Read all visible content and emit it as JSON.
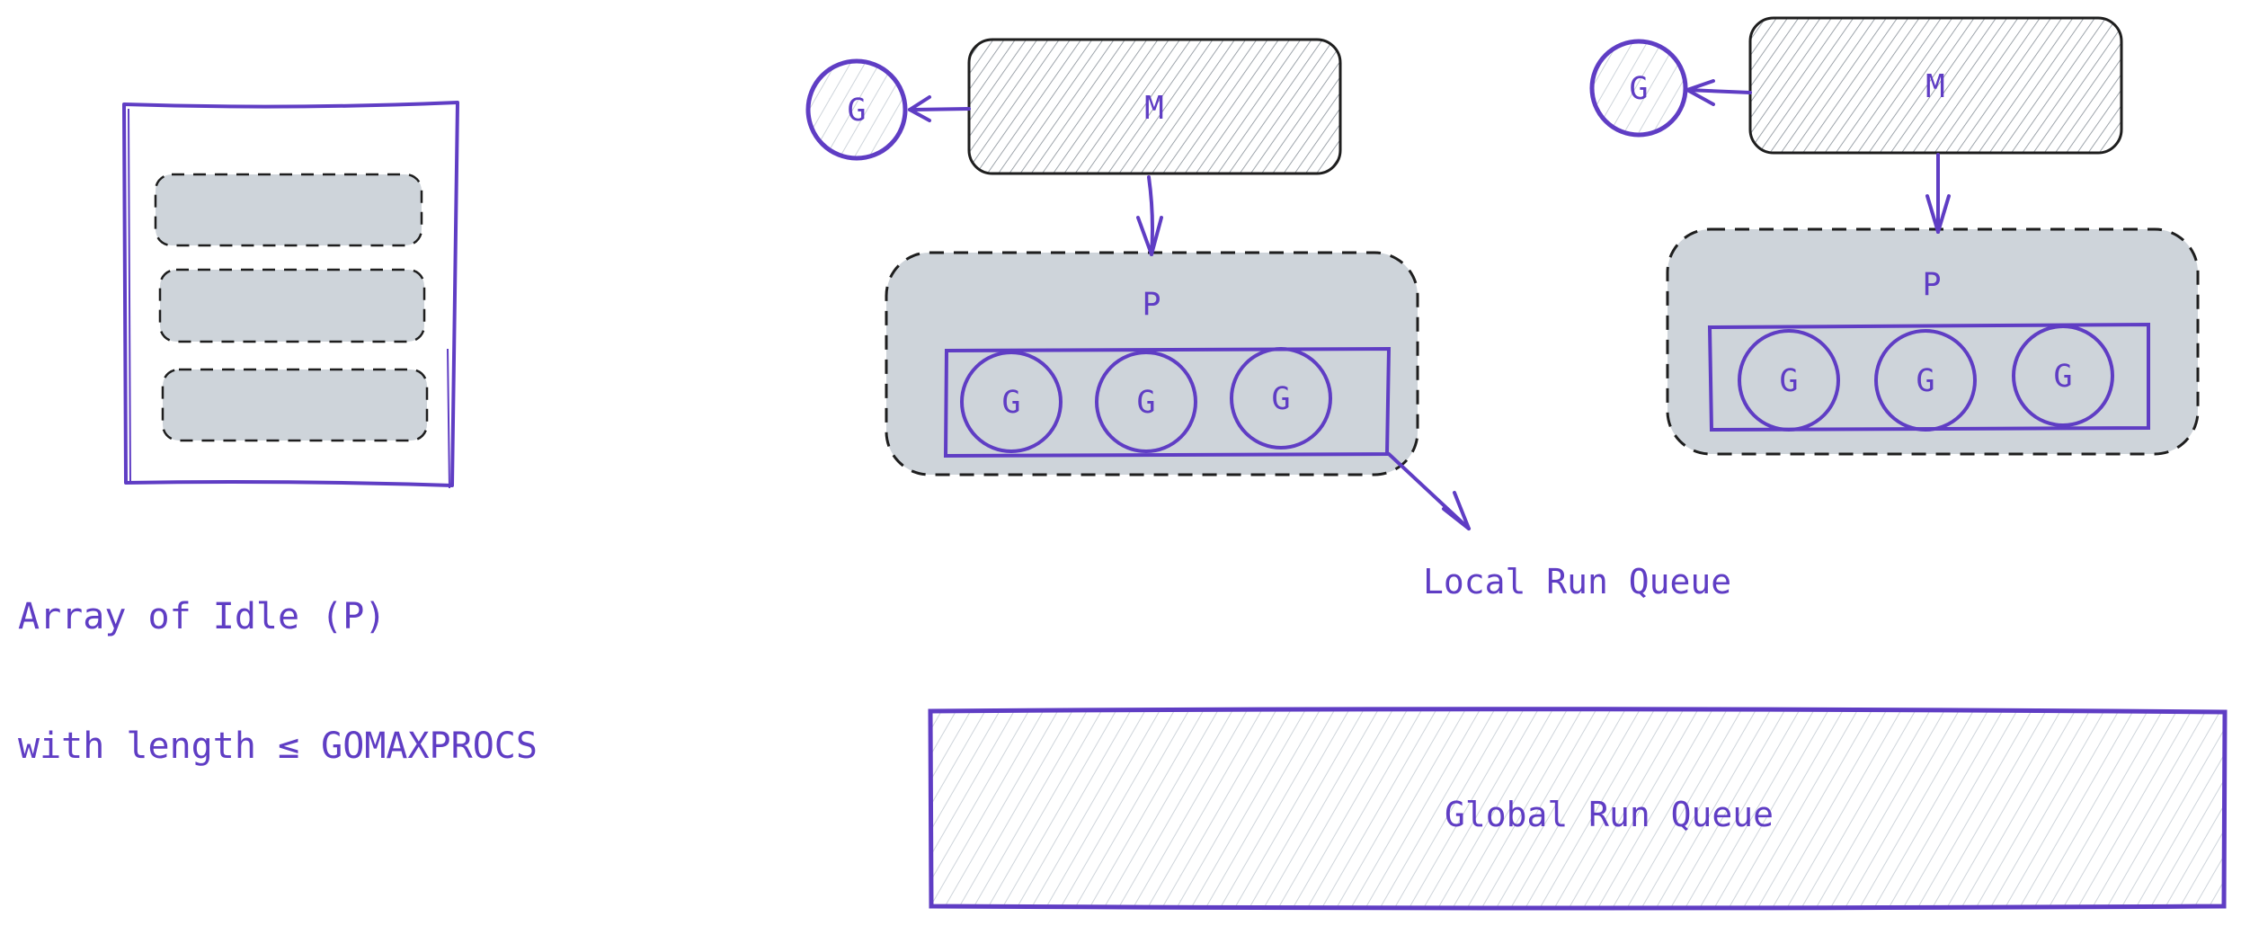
{
  "colors": {
    "accent": "#5f3dc4",
    "box_fill": "#ced4da",
    "hatch": "#868e96",
    "hatch_light": "#ced4da",
    "stroke_dark": "#1e1e1e"
  },
  "idle_array": {
    "caption_line1": "Array of Idle (P)",
    "caption_line2": "with length ≤ GOMAXPROCS",
    "slot_count": 3
  },
  "machines": [
    {
      "m_label": "M",
      "running_g_label": "G",
      "p_label": "P",
      "local_queue": [
        "G",
        "G",
        "G"
      ]
    },
    {
      "m_label": "M",
      "running_g_label": "G",
      "p_label": "P",
      "local_queue": [
        "G",
        "G",
        "G"
      ]
    }
  ],
  "local_queue_label": "Local Run Queue",
  "global_queue_label": "Global Run Queue"
}
